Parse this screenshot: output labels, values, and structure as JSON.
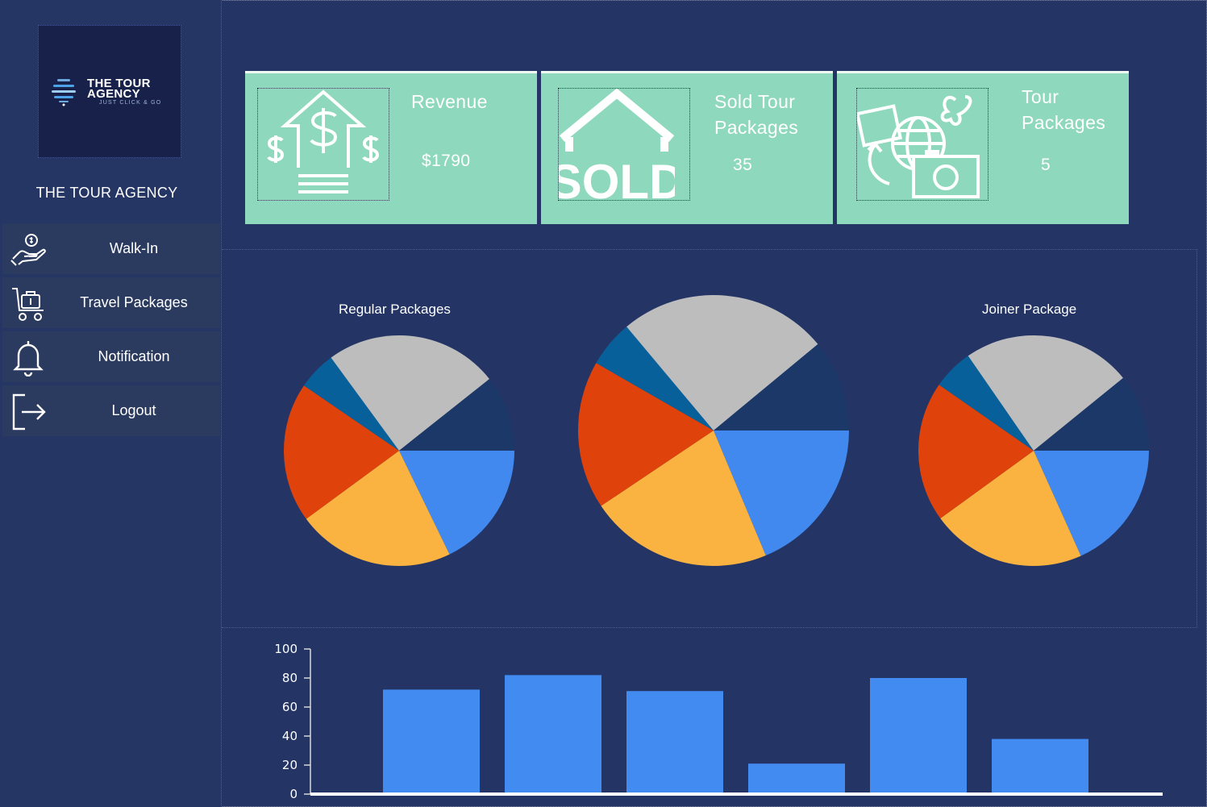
{
  "brand": {
    "logo_line1": "THE TOUR",
    "logo_line2": "AGENCY",
    "tagline": "JUST CLICK & GO",
    "name": "THE TOUR AGENCY"
  },
  "nav": [
    {
      "label": "Walk-In",
      "icon": "hand-coin-icon"
    },
    {
      "label": "Travel Packages",
      "icon": "luggage-cart-icon"
    },
    {
      "label": "Notification",
      "icon": "bell-icon"
    },
    {
      "label": "Logout",
      "icon": "logout-icon"
    }
  ],
  "cards": {
    "revenue": {
      "title": "Revenue",
      "value": "$1790",
      "icon": "revenue-up-icon"
    },
    "sold": {
      "title_line1": "Sold Tour",
      "title_line2": "Packages",
      "value": "35",
      "icon": "sold-house-icon"
    },
    "packages": {
      "title_line1": "Tour",
      "title_line2": "Packages",
      "value": "5",
      "icon": "travel-globe-camera-icon"
    }
  },
  "colors": {
    "background": "#243565",
    "card": "#8ed8bd",
    "bar": "#428bf0",
    "pie": [
      "#4189ee",
      "#fab341",
      "#df430b",
      "#08609a",
      "#bdbdbd",
      "#1b3868"
    ]
  },
  "chart_data": [
    {
      "type": "pie",
      "title": "Regular Packages",
      "values": [
        16.5,
        20.5,
        18.2,
        5.0,
        22.6,
        9.9
      ],
      "colors": [
        "#4189ee",
        "#fab341",
        "#df430b",
        "#08609a",
        "#bdbdbd",
        "#1b3868"
      ]
    },
    {
      "type": "pie",
      "title": "",
      "values": [
        18.7,
        21.9,
        17.7,
        5.6,
        25.1,
        11.0
      ],
      "colors": [
        "#4189ee",
        "#fab341",
        "#df430b",
        "#08609a",
        "#bdbdbd",
        "#1b3868"
      ]
    },
    {
      "type": "pie",
      "title": "Joiner Package",
      "values": [
        17.0,
        20.2,
        18.3,
        5.3,
        22.1,
        10.1
      ],
      "colors": [
        "#4189ee",
        "#fab341",
        "#df430b",
        "#08609a",
        "#bdbdbd",
        "#1b3868"
      ]
    },
    {
      "type": "bar",
      "categories": [
        "",
        "",
        "",
        "",
        "",
        ""
      ],
      "values": [
        72,
        82,
        71,
        21,
        80,
        38
      ],
      "ylim": [
        0,
        100
      ],
      "yticks": [
        "0",
        "20",
        "40",
        "60",
        "80",
        "100"
      ],
      "grid": false,
      "color": "#428bf0"
    }
  ]
}
